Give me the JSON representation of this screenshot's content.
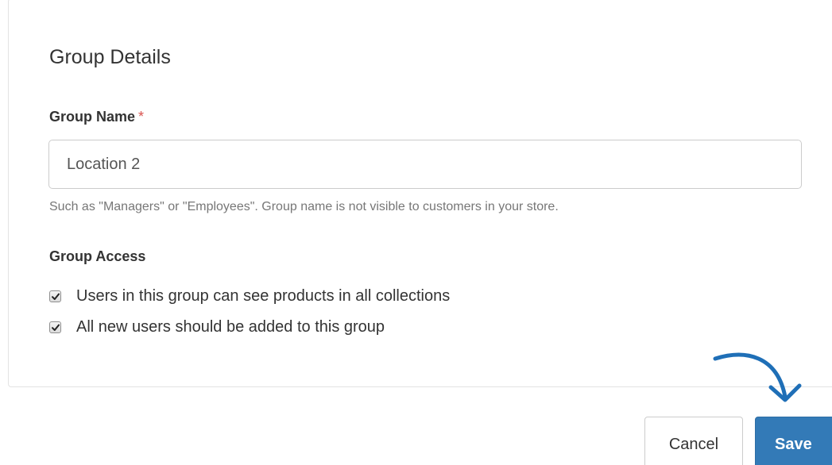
{
  "panel": {
    "title": "Group Details"
  },
  "group_name": {
    "label": "Group Name",
    "required_mark": "*",
    "value": "Location 2",
    "help_text": "Such as \"Managers\" or \"Employees\". Group name is not visible to customers in your store."
  },
  "group_access": {
    "label": "Group Access",
    "options": [
      {
        "label": "Users in this group can see products in all collections",
        "checked": true
      },
      {
        "label": "All new users should be added to this group",
        "checked": true
      }
    ]
  },
  "actions": {
    "cancel_label": "Cancel",
    "save_label": "Save"
  },
  "annotation": {
    "icon": "curved-arrow-icon",
    "color": "#1f6fb7"
  },
  "colors": {
    "primary": "#337ab7",
    "required": "#d9534f"
  }
}
